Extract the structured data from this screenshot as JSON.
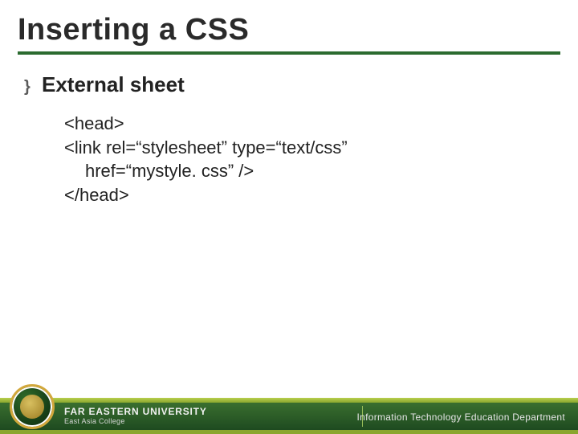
{
  "title": "Inserting a CSS",
  "bullet": {
    "glyph": "}",
    "text": "External sheet"
  },
  "code": {
    "l1": "<head>",
    "l2": "<link rel=“stylesheet” type=“text/css”",
    "l3": "href=“mystyle. css” />",
    "l4": "</head>"
  },
  "footer": {
    "university": "FAR EASTERN UNIVERSITY",
    "college": "East Asia College",
    "department": "Information Technology Education Department"
  }
}
